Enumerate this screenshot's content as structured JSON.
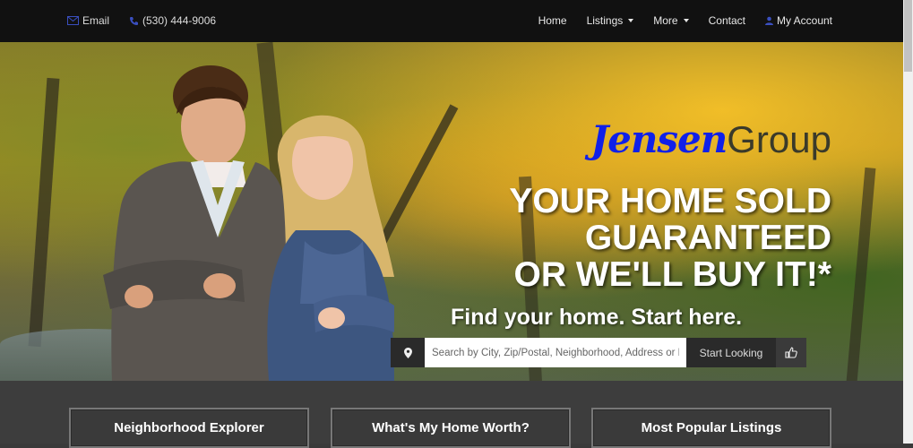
{
  "nav": {
    "email_label": "Email",
    "phone_label": "(530) 444-9006",
    "home_label": "Home",
    "listings_label": "Listings",
    "more_label": "More",
    "contact_label": "Contact",
    "account_label": "My Account"
  },
  "hero": {
    "logo_part1": "Jensen",
    "logo_part2": "Group",
    "headline_line1": "YOUR HOME SOLD",
    "headline_line2": "GUARANTEED",
    "headline_line3": "OR WE'LL BUY IT!*",
    "subheadline": "Find your home. Start here.",
    "search_placeholder": "Search by City, Zip/Postal, Neighborhood, Address or MLS#",
    "search_button": "Start Looking"
  },
  "cards": [
    {
      "label": "Neighborhood Explorer"
    },
    {
      "label": "What's My Home Worth?"
    },
    {
      "label": "Most Popular Listings"
    }
  ],
  "colors": {
    "navbar_bg": "#111111",
    "logo_accent": "#1020e8",
    "bottom_bg": "#3d3d3d"
  }
}
